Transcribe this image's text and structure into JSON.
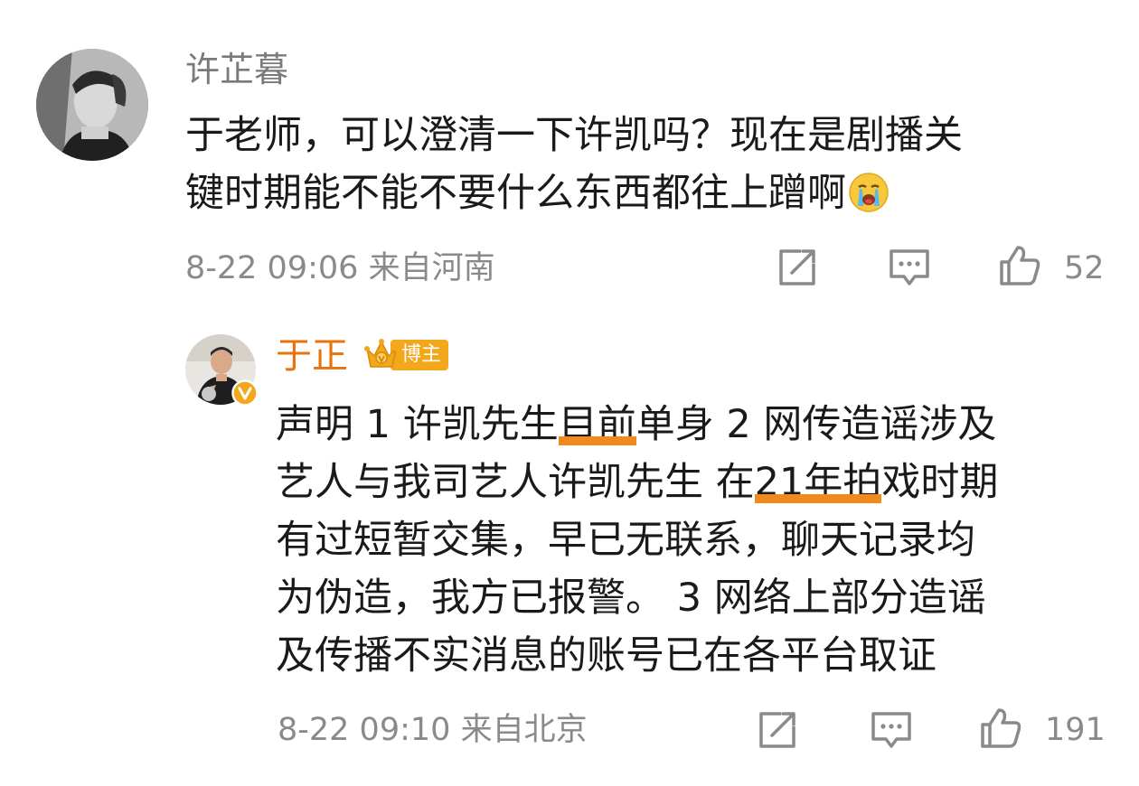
{
  "comments": [
    {
      "username": "许芷暮",
      "avatar_icon": "user-avatar",
      "text_lines": [
        "于老师，可以澄清一下许凯吗？现在是剧播关",
        "键时期能不能不要什么东西都往上蹭啊"
      ],
      "emoji_icon": "crying-face-emoji",
      "timestamp": "8-22 09:06",
      "location": "来自河南",
      "likes": "52"
    },
    {
      "username": "于正",
      "avatar_icon": "user-avatar",
      "verified_icon": "verified-v-icon",
      "badge_icon": "crown-badge-icon",
      "badge_label": "博主",
      "text_lines": [
        {
          "a": "声明 1 许凯先生",
          "hl": "目前",
          "b": "单身 2 网传造谣涉及"
        },
        {
          "a": "艺人与我司艺人许凯先生 在",
          "hl": "21年拍",
          "b": "戏时期"
        },
        {
          "a": "有过短暂交集，早已无联系，聊天记录均",
          "hl": "",
          "b": ""
        },
        {
          "a": "为伪造，我方已报警。 3 网络上部分造谣",
          "hl": "",
          "b": ""
        },
        {
          "a": "及传播不实消息的账号已在各平台取证",
          "hl": "",
          "b": ""
        }
      ],
      "highlight_color": "#f08a1c",
      "username_color": "#e8720c",
      "timestamp": "8-22 09:10",
      "location": "来自北京",
      "likes": "191"
    }
  ],
  "action_icons": [
    "share-icon",
    "comment-icon",
    "like-icon"
  ]
}
